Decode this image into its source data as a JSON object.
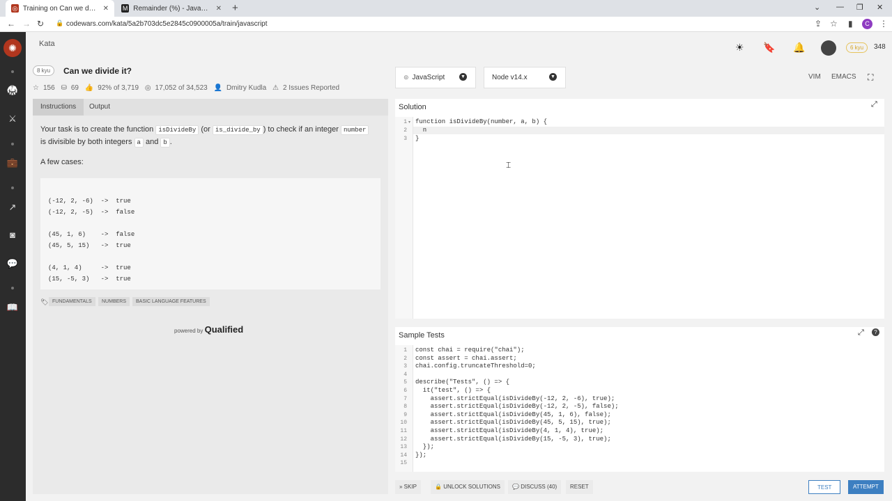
{
  "browser": {
    "tabs": [
      {
        "title": "Training on Can we divide it? | Co",
        "active": true
      },
      {
        "title": "Remainder (%) - JavaScript | MDN",
        "active": false
      }
    ],
    "new_tab_label": "+",
    "url": "codewars.com/kata/5a2b703dc5e2845c0900005a/train/javascript",
    "profile_initial": "C"
  },
  "sidebar": {
    "icons": [
      "codewars-logo",
      "dojo-icon",
      "practice-icon",
      "briefcase-icon",
      "leaderboard-icon",
      "discord-icon",
      "chat-icon",
      "docs-icon"
    ]
  },
  "topbar": {
    "kata_link": "Kata",
    "rank": "6 kyu",
    "honor": "348"
  },
  "kata": {
    "kyu": "8 kyu",
    "title": "Can we divide it?",
    "stars": "156",
    "collections": "69",
    "satisfaction": "92% of 3,719",
    "completed": "17,052 of 34,523",
    "author": "Dmitry Kudla",
    "issues": "2 Issues Reported"
  },
  "left_tabs": {
    "instructions": "Instructions",
    "output": "Output"
  },
  "description": {
    "p1_a": "Your task is to create the function ",
    "code1": "isDivideBy",
    "p1_b": " (or ",
    "code2": "is_divide_by",
    "p1_c": ") to check if an integer ",
    "code3": "number",
    "p1_d": " is divisible by both integers ",
    "code4": "a",
    "p1_e": " and ",
    "code5": "b",
    "p1_f": ".",
    "cases_label": "A few cases:",
    "cases": [
      "(-12, 2, -6)  ->  true",
      "(-12, 2, -5)  ->  false",
      "(45, 1, 6)    ->  false",
      "(45, 5, 15)   ->  true",
      "(4, 1, 4)     ->  true",
      "(15, -5, 3)   ->  true"
    ]
  },
  "tags": [
    "FUNDAMENTALS",
    "NUMBERS",
    "BASIC LANGUAGE FEATURES"
  ],
  "powered_by": {
    "prefix": "powered by",
    "brand": "Qualified"
  },
  "editor": {
    "language": "JavaScript",
    "runtime": "Node v14.x",
    "modes": [
      "VIM",
      "EMACS"
    ],
    "solution_title": "Solution",
    "solution_lines": [
      "function isDivideBy(number, a, b) {",
      "  n",
      "}"
    ],
    "tests_title": "Sample Tests",
    "test_lines": [
      "const chai = require(\"chai\");",
      "const assert = chai.assert;",
      "chai.config.truncateThreshold=0;",
      "",
      "describe(\"Tests\", () => {",
      "  it(\"test\", () => {",
      "    assert.strictEqual(isDivideBy(-12, 2, -6), true);",
      "    assert.strictEqual(isDivideBy(-12, 2, -5), false);",
      "    assert.strictEqual(isDivideBy(45, 1, 6), false);",
      "    assert.strictEqual(isDivideBy(45, 5, 15), true);",
      "    assert.strictEqual(isDivideBy(4, 1, 4), true);",
      "    assert.strictEqual(isDivideBy(15, -5, 3), true);",
      "  });",
      "});",
      ""
    ]
  },
  "actions": {
    "skip": "SKIP",
    "unlock": "UNLOCK SOLUTIONS",
    "discuss": "DISCUSS (40)",
    "reset": "RESET",
    "test": "TEST",
    "attempt": "ATTEMPT"
  },
  "colors": {
    "brand": "#b1361e",
    "attempt": "#3d7fc1",
    "test_border": "#3d7fc1",
    "rank": "#d4a52b"
  }
}
